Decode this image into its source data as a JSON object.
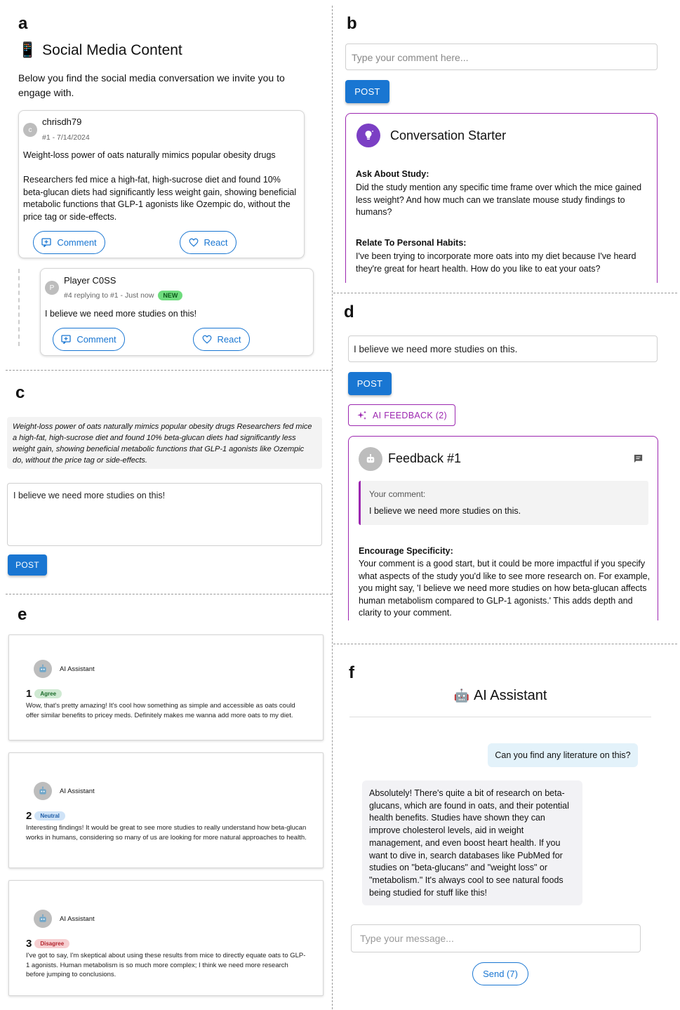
{
  "panels": {
    "a": "a",
    "b": "b",
    "c": "c",
    "d": "d",
    "e": "e",
    "f": "f"
  },
  "a": {
    "icon": "📱",
    "title": "Social Media Content",
    "intro": "Below you find the social media conversation we invite you to engage with.",
    "post": {
      "avatar": "c",
      "user": "chrisdh79",
      "meta": "#1 - 7/14/2024",
      "headline": "Weight-loss power of oats naturally mimics popular obesity drugs",
      "body": "Researchers fed mice a high-fat, high-sucrose diet and found 10% beta-glucan diets had significantly less weight gain, showing beneficial metabolic functions that GLP-1 agonists like Ozempic do, without the price tag or side-effects.",
      "comment_label": "Comment",
      "react_label": "React"
    },
    "reply": {
      "avatar": "P",
      "user": "Player C0SS",
      "meta": "#4 replying to #1 - Just now",
      "badge": "NEW",
      "body": "I believe we need more studies on this!",
      "comment_label": "Comment",
      "react_label": "React"
    }
  },
  "b": {
    "placeholder": "Type your comment here...",
    "post_label": "POST",
    "starter_title": "Conversation Starter",
    "sections": [
      {
        "heading": "Ask About Study:",
        "text": "Did the study mention any specific time frame over which the mice gained less weight? And how much can we translate mouse study findings to humans?"
      },
      {
        "heading": "Relate To Personal Habits:",
        "text": "I've been trying to incorporate more oats into my diet because I've heard they're great for heart health. How do you like to eat your oats?"
      }
    ]
  },
  "c": {
    "quote": "Weight-loss power of oats naturally mimics popular obesity drugs Researchers fed mice a high-fat, high-sucrose diet and found 10% beta-glucan diets had significantly less weight gain, showing beneficial metabolic functions that GLP-1 agonists like Ozempic do, without the price tag or side-effects.",
    "comment": "I believe we need more studies on this!",
    "post_label": "POST"
  },
  "d": {
    "comment": "I believe we need more studies on this.",
    "post_label": "POST",
    "ai_feedback_label": "AI FEEDBACK (2)",
    "feedback_title": "Feedback #1",
    "your_comment_label": "Your comment:",
    "your_comment": "I believe we need more studies on this.",
    "section_heading": "Encourage Specificity:",
    "section_text": "Your comment is a good start, but it could be more impactful if you specify what aspects of the study you'd like to see more research on. For example, you might say, 'I believe we need more studies on how beta-glucan affects human metabolism compared to GLP-1 agonists.' This adds depth and clarity to your comment."
  },
  "e": {
    "cards": [
      {
        "name": "AI Assistant",
        "number": "1",
        "label": "Agree",
        "text": "Wow, that's pretty amazing! It's cool how something as simple and accessible as oats could offer similar benefits to pricey meds. Definitely makes me wanna add more oats to my diet."
      },
      {
        "name": "AI Assistant",
        "number": "2",
        "label": "Neutral",
        "text": "Interesting findings! It would be great to see more studies to really understand how beta-glucan works in humans, considering so many of us are looking for more natural approaches to health."
      },
      {
        "name": "AI Assistant",
        "number": "3",
        "label": "Disagree",
        "text": "I've got to say, I'm skeptical about using these results from mice to directly equate oats to GLP-1 agonists. Human metabolism is so much more complex; I think we need more research before jumping to conclusions."
      }
    ],
    "colors": {
      "agree_bg": "#cfe9d2",
      "agree_fg": "#1b6b2a",
      "neutral_bg": "#cfe3f7",
      "neutral_fg": "#1f5ea8",
      "disagree_bg": "#f6cfd1",
      "disagree_fg": "#b3232d"
    }
  },
  "f": {
    "icon": "🤖",
    "title": "AI Assistant",
    "user_msg": "Can you find any literature on this?",
    "assistant_msg": "Absolutely! There's quite a bit of research on beta-glucans, which are found in oats, and their potential health benefits. Studies have shown they can improve cholesterol levels, aid in weight management, and even boost heart health. If you want to dive in, search databases like PubMed for studies on \"beta-glucans\" and \"weight loss\" or \"metabolism.\" It's always cool to see natural foods being studied for stuff like this!",
    "placeholder": "Type your message...",
    "send_label": "Send (7)"
  },
  "theme": {
    "primary": "#1976d2",
    "purple": "#9c27b0",
    "user_bubble": "#e3f2fa",
    "assistant_bubble": "#f2f2f5"
  }
}
